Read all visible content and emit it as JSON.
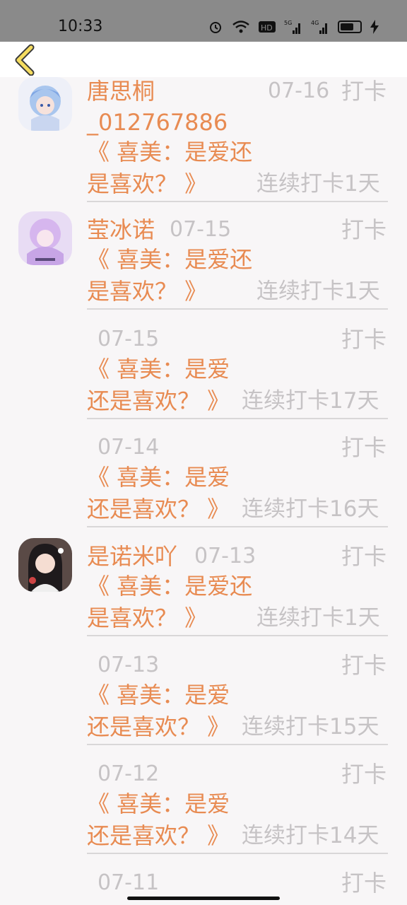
{
  "status_bar": {
    "time": "10:33",
    "icons": [
      "alarm-icon",
      "wifi-icon",
      "hd-icon",
      "5g-signal-icon",
      "4g-signal-icon",
      "battery-icon",
      "charging-icon"
    ]
  },
  "nav": {
    "back_icon": "chevron-left-icon"
  },
  "entries": [
    {
      "name": "唐思桐",
      "name2": "_012767886",
      "date": "07-16",
      "action": "打卡",
      "book_line1": "《 喜美：是爱还",
      "book_line2": "是喜欢？ 》",
      "streak": "连续打卡1天"
    },
    {
      "name": "莹冰诺",
      "date": "07-15",
      "action": "打卡",
      "book_line1": "《 喜美：是爱还",
      "book_line2": "是喜欢？ 》",
      "streak": "连续打卡1天"
    },
    {
      "date": "07-15",
      "action": "打卡",
      "book_line1": "《 喜美：是爱",
      "book_line2": "还是喜欢？ 》",
      "streak": "连续打卡17天"
    },
    {
      "date": "07-14",
      "action": "打卡",
      "book_line1": "《 喜美：是爱",
      "book_line2": "还是喜欢？ 》",
      "streak": "连续打卡16天"
    },
    {
      "name": "是诺米吖",
      "date": "07-13",
      "action": "打卡",
      "book_line1": "《 喜美：是爱还",
      "book_line2": "是喜欢？ 》",
      "streak": "连续打卡1天"
    },
    {
      "date": "07-13",
      "action": "打卡",
      "book_line1": "《 喜美：是爱",
      "book_line2": "还是喜欢？ 》",
      "streak": "连续打卡15天"
    },
    {
      "date": "07-12",
      "action": "打卡",
      "book_line1": "《 喜美：是爱",
      "book_line2": "还是喜欢？ 》",
      "streak": "连续打卡14天"
    },
    {
      "date": "07-11",
      "action": "打卡"
    }
  ],
  "colors": {
    "accent": "#e88b52",
    "muted": "#c6c3c5",
    "background": "#f8f6f7"
  }
}
